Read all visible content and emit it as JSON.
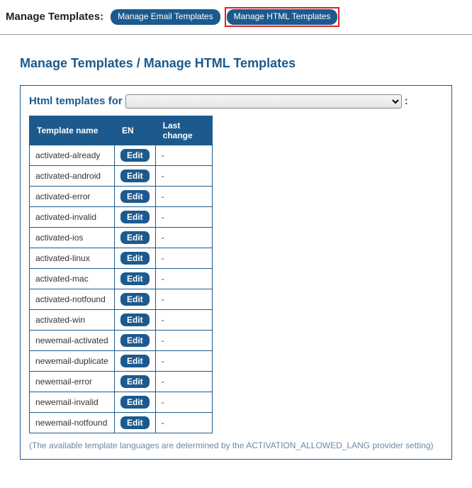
{
  "topbar": {
    "label": "Manage Templates:",
    "email_btn": "Manage Email Templates",
    "html_btn": "Manage HTML Templates"
  },
  "page_title": "Manage Templates / Manage HTML Templates",
  "panel": {
    "header_label": "Html templates for",
    "selected_account": "",
    "colon": ":"
  },
  "table": {
    "headers": {
      "name": "Template name",
      "en": "EN",
      "last": "Last change"
    },
    "edit_label": "Edit",
    "rows": [
      {
        "name": "activated-already",
        "last": "-"
      },
      {
        "name": "activated-android",
        "last": "-"
      },
      {
        "name": "activated-error",
        "last": "-"
      },
      {
        "name": "activated-invalid",
        "last": "-"
      },
      {
        "name": "activated-ios",
        "last": "-"
      },
      {
        "name": "activated-linux",
        "last": "-"
      },
      {
        "name": "activated-mac",
        "last": "-"
      },
      {
        "name": "activated-notfound",
        "last": "-"
      },
      {
        "name": "activated-win",
        "last": "-"
      },
      {
        "name": "newemail-activated",
        "last": "-"
      },
      {
        "name": "newemail-duplicate",
        "last": "-"
      },
      {
        "name": "newemail-error",
        "last": "-"
      },
      {
        "name": "newemail-invalid",
        "last": "-"
      },
      {
        "name": "newemail-notfound",
        "last": "-"
      }
    ]
  },
  "note": "(The available template languages are determined by the ACTIVATION_ALLOWED_LANG provider setting)"
}
